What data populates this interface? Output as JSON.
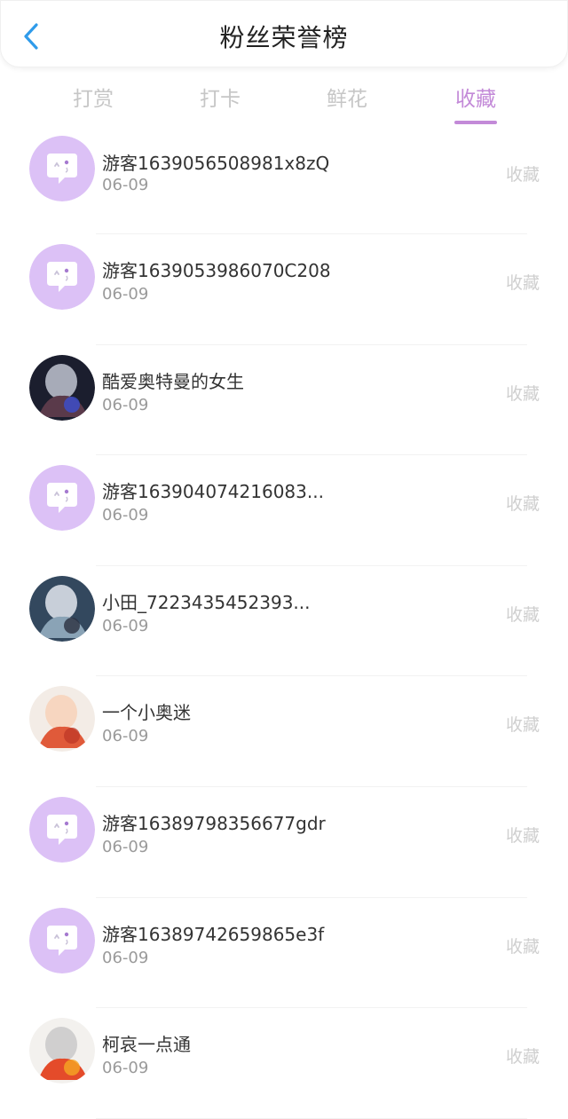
{
  "header": {
    "title": "粉丝荣誉榜"
  },
  "tabs": [
    {
      "label": "打赏",
      "active": false
    },
    {
      "label": "打卡",
      "active": false
    },
    {
      "label": "鲜花",
      "active": false
    },
    {
      "label": "收藏",
      "active": true
    }
  ],
  "items": [
    {
      "name": "游客1639056508981x8zQ",
      "date": "06-09",
      "action": "收藏",
      "avatar": "default-chat-avatar"
    },
    {
      "name": "游客1639053986070C208",
      "date": "06-09",
      "action": "收藏",
      "avatar": "default-chat-avatar"
    },
    {
      "name": "酷爱奥特曼的女生",
      "date": "06-09",
      "action": "收藏",
      "avatar": "ultraman-photo"
    },
    {
      "name": "游客163904074216083...",
      "date": "06-09",
      "action": "收藏",
      "avatar": "default-chat-avatar"
    },
    {
      "name": "小田_7223435452393...",
      "date": "06-09",
      "action": "收藏",
      "avatar": "anime-photo"
    },
    {
      "name": "一个小奥迷",
      "date": "06-09",
      "action": "收藏",
      "avatar": "anime-red-photo"
    },
    {
      "name": "游客16389798356677gdr",
      "date": "06-09",
      "action": "收藏",
      "avatar": "default-chat-avatar"
    },
    {
      "name": "游客16389742659865e3f",
      "date": "06-09",
      "action": "收藏",
      "avatar": "default-chat-avatar"
    },
    {
      "name": "柯哀一点通",
      "date": "06-09",
      "action": "收藏",
      "avatar": "anime-white-hair-photo"
    }
  ],
  "colors": {
    "accent": "#c38ad8",
    "avatar_bg": "#dcc1f6"
  }
}
